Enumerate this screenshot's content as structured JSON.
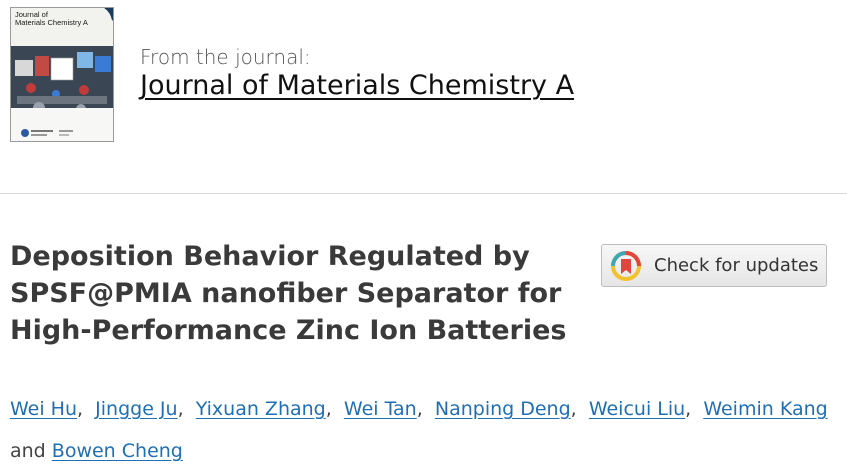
{
  "journal": {
    "cover_title_line1": "Journal of",
    "cover_title_line2": "Materials Chemistry A",
    "from_label": "From the journal:",
    "name": "Journal of Materials Chemistry A"
  },
  "article": {
    "title_lines": [
      "Deposition Behavior Regulated by",
      "SPSF@PMIA nanofiber Separator for",
      "High-Performance Zinc Ion Batteries"
    ]
  },
  "updates_button": {
    "label": "Check for updates",
    "icon": "crossmark-icon",
    "colors": {
      "yellow": "#f2c12e",
      "red": "#e2453c",
      "teal": "#3fa7b3"
    }
  },
  "authors": {
    "list": [
      "Wei Hu",
      "Jingge Ju",
      "Yixuan Zhang",
      "Wei Tan",
      "Nanping Deng",
      "Weicui Liu",
      "Weimin Kang",
      "Bowen Cheng"
    ],
    "separator": ",",
    "conjunction": "and",
    "link_color": "#1f6fb5"
  }
}
